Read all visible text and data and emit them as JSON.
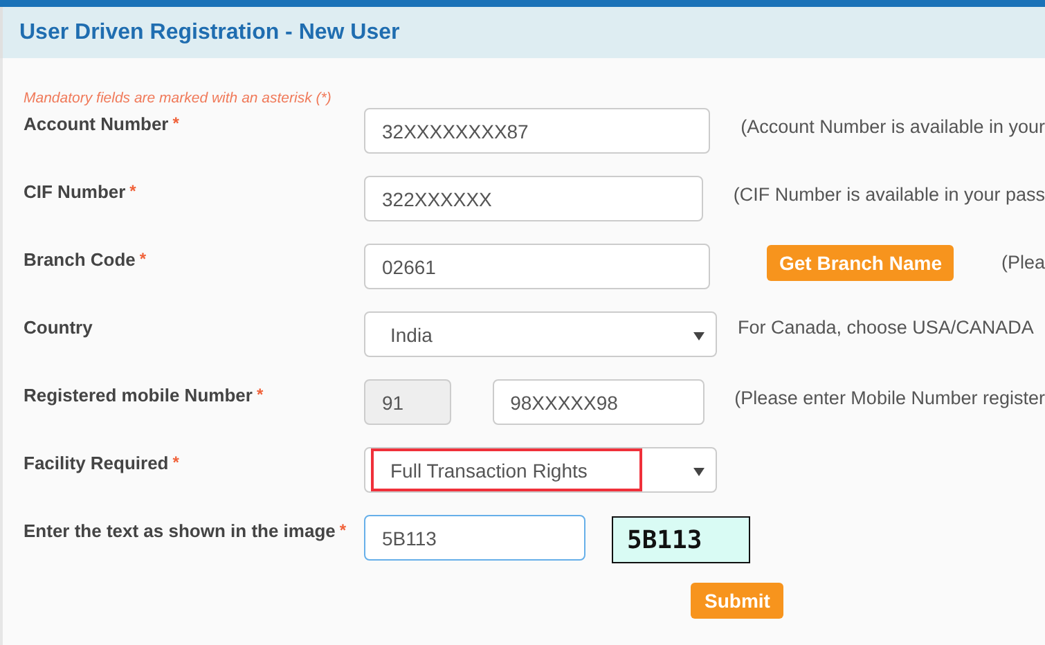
{
  "header": {
    "title": "User Driven Registration - New User"
  },
  "notice": "Mandatory fields are marked with an asterisk (*)",
  "rows": [
    {
      "kind": "text",
      "label": "Account Number",
      "marker": "*",
      "value": "32XXXXXXXX87",
      "note": "(Account Number is available in your"
    },
    {
      "kind": "text",
      "label": "CIF Number",
      "marker": "*",
      "value": "322XXXXXX",
      "note": "(CIF Number is available in your pass"
    },
    {
      "kind": "button",
      "label": "Branch Code",
      "marker": "*",
      "value": "02661",
      "button": "Get Branch Name",
      "note": "(Plea"
    },
    {
      "kind": "select",
      "label": "Country",
      "value": "India",
      "highlighted": false,
      "note": "For Canada, choose USA/CANADA"
    },
    {
      "kind": "mobile",
      "label": "Registered mobile Number",
      "marker": "*",
      "code": "91",
      "value": "98XXXXX98",
      "note": "(Please enter Mobile Number register"
    },
    {
      "kind": "select",
      "label": "Facility Required",
      "marker": "*",
      "value": "Full Transaction Rights",
      "highlighted": true
    },
    {
      "kind": "captcha",
      "label": "Enter the text as shown in the image",
      "marker": "*",
      "value": "5B113",
      "focused": true,
      "captcha": "5B113"
    }
  ],
  "submit": "Submit"
}
